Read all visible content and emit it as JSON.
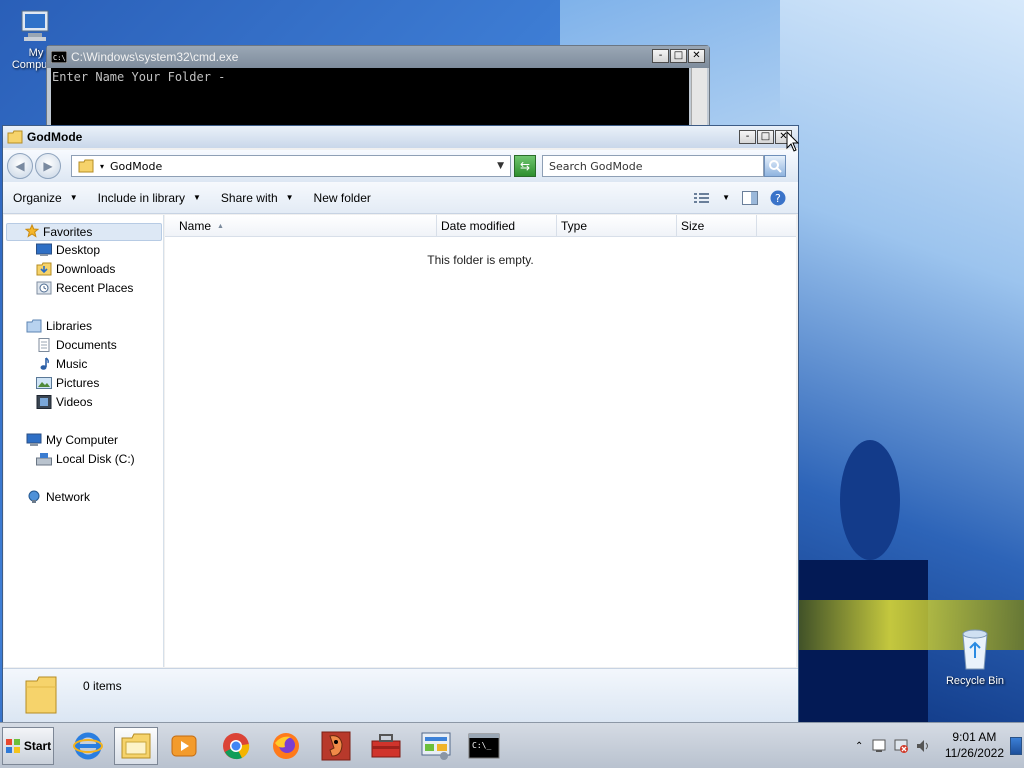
{
  "desktop": {
    "icons": [
      {
        "label": "My Computer",
        "icon": "computer-icon"
      },
      {
        "label": "Recycle Bin",
        "icon": "recycle-bin-icon"
      }
    ]
  },
  "cmd_window": {
    "title": "C:\\Windows\\system32\\cmd.exe",
    "console_text": "Enter Name Your Folder -",
    "buttons": {
      "minimize": "-",
      "maximize": "□",
      "close": "✕"
    }
  },
  "explorer": {
    "title": "GodMode",
    "address": "GodMode",
    "search_placeholder": "Search GodMode",
    "toolbar": {
      "organize": "Organize",
      "include_in_library": "Include in library",
      "share_with": "Share with",
      "new_folder": "New folder"
    },
    "nav": {
      "favorites": "Favorites",
      "desktop": "Desktop",
      "downloads": "Downloads",
      "recent_places": "Recent Places",
      "libraries": "Libraries",
      "documents": "Documents",
      "music": "Music",
      "pictures": "Pictures",
      "videos": "Videos",
      "my_computer": "My Computer",
      "local_disk": "Local Disk (C:)",
      "network": "Network"
    },
    "columns": [
      "Name",
      "Date modified",
      "Type",
      "Size"
    ],
    "empty_message": "This folder is empty.",
    "item_count": "0 items"
  },
  "taskbar": {
    "start_label": "Start",
    "apps": [
      "internet-explorer-icon",
      "windows-explorer-icon",
      "media-player-icon",
      "chrome-icon",
      "firefox-icon",
      "app-icon",
      "toolbox-icon",
      "control-panel-icon",
      "cmd-icon"
    ],
    "time": "9:01 AM",
    "date": "11/26/2022"
  }
}
